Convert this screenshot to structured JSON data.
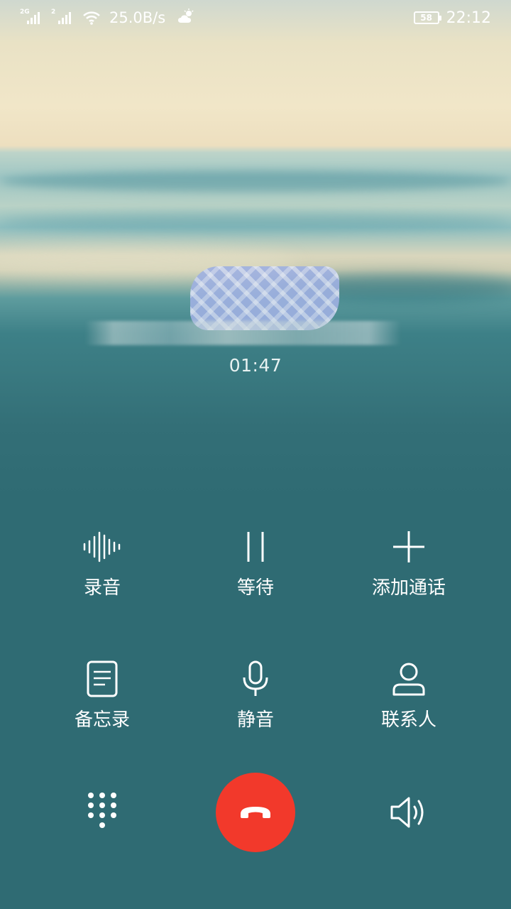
{
  "status_bar": {
    "sim1_tag": "2G",
    "sim2_tag": "2",
    "net_speed": "25.0B/s",
    "battery_level": "58",
    "time": "22:12"
  },
  "call": {
    "timer": "01:47"
  },
  "actions": [
    {
      "label": "录音",
      "icon": "waveform-icon"
    },
    {
      "label": "等待",
      "icon": "pause-icon"
    },
    {
      "label": "添加通话",
      "icon": "plus-icon"
    },
    {
      "label": "备忘录",
      "icon": "notes-icon"
    },
    {
      "label": "静音",
      "icon": "microphone-icon"
    },
    {
      "label": "联系人",
      "icon": "person-icon"
    }
  ],
  "bottom_bar": {
    "dialpad_icon": "dialpad-icon",
    "end_call_icon": "hang-up-icon",
    "end_call_color": "#f2392b",
    "speaker_icon": "speaker-icon"
  }
}
